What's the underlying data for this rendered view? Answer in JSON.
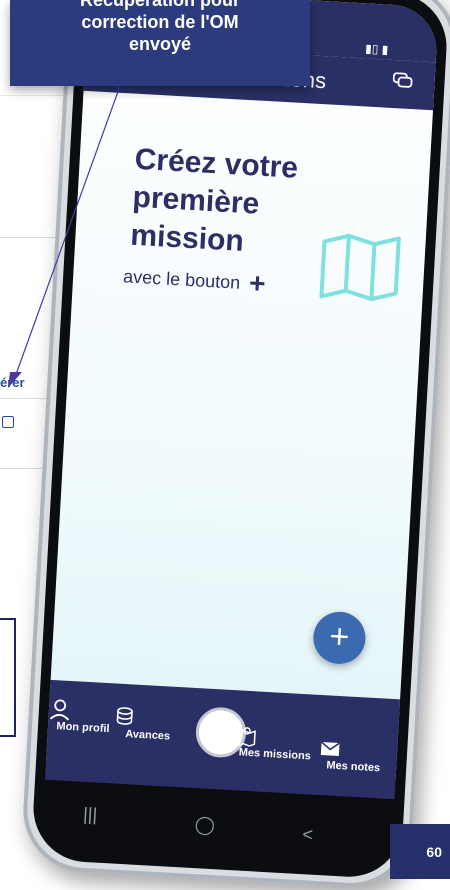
{
  "callout": {
    "line0": "Récupération pour",
    "line1": "correction de l'OM",
    "line2": "envoyé"
  },
  "background": {
    "link_fragment": "érer",
    "page_number": "60"
  },
  "phone": {
    "header": {
      "title": "Mes missions"
    },
    "empty_state": {
      "title_line1": "Créez votre",
      "title_line2": "première",
      "title_line3": "mission",
      "subtitle": "avec le bouton",
      "plus_glyph": "+"
    },
    "fab_label": "+",
    "tabs": [
      {
        "label": "Mon profil",
        "icon": "person-icon"
      },
      {
        "label": "Avances",
        "icon": "coins-icon"
      },
      {
        "label": "Mes missions",
        "icon": "map-pin-icon"
      },
      {
        "label": "Mes notes",
        "icon": "envelope-icon"
      }
    ],
    "system_nav": {
      "recents": "|||",
      "home": "◯",
      "back": "<"
    }
  },
  "colors": {
    "navy": "#2a2f66",
    "callout_bg": "#2c3a7e",
    "fab": "#3c6ab0",
    "map_icon": "#7fe0e0"
  }
}
